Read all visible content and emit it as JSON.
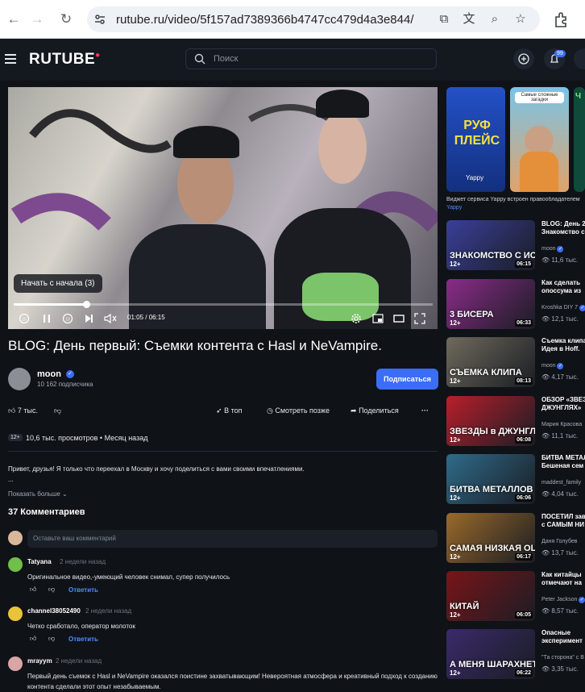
{
  "browser": {
    "url": "rutube.ru/video/5f157ad7389366b4747cc479d4a3e844/"
  },
  "header": {
    "logo": "RUTUBE",
    "search_placeholder": "Поиск",
    "notifications_count": "99"
  },
  "player": {
    "tooltip": "Начать с начала (3)",
    "current_time": "01:05",
    "duration": "06:15",
    "time_display": "01:05 / 06:15",
    "progress": 0.173
  },
  "video": {
    "title": "BLOG: День первый: Съемки контента с Hasl и NeVampire.",
    "channel": "moon",
    "subscribers": "10 162 подписчика",
    "subscribe_label": "Подписаться",
    "likes": "7 тыс.",
    "to_top_label": "В топ",
    "watch_later_label": "Смотреть позже",
    "share_label": "Поделиться",
    "age_rating": "12+",
    "views": "10,6 тыс. просмотров",
    "published": "Месяц назад",
    "description_line1": "Привет, друзья! Я только что переехал в Москву и хочу поделиться с вами своими впечатлениями.",
    "description_line2": "...",
    "show_more": "Показать больше"
  },
  "comments": {
    "count_label": "37 Комментариев",
    "input_placeholder": "Оставьте ваш комментарий",
    "reply_label": "Ответить",
    "items": [
      {
        "author": "Tatyana",
        "date": "2 недели назад",
        "text": "Оригинальное видео,-умеющий человек снимал, супер получилось",
        "color": "#6fbf4a"
      },
      {
        "author": "channel38052490",
        "date": "2 недели назад",
        "text": "Четко сработало, оператор молоток",
        "color": "#e9c33a"
      },
      {
        "author": "mrayym",
        "date": "2 недели назад",
        "text": "Первый день съемок с Hasl и NeVampire оказался поистине захватывающим! Невероятная атмосфера и креативный подход к созданию контента сделали этот опыт незабываемым.",
        "color": "#d9a5a5"
      }
    ]
  },
  "sidebar": {
    "shorts": [
      {
        "label": "РУФ ПЛЕЙС",
        "sub": "Yappy",
        "color": "#1b3fa0"
      },
      {
        "label": "Самые сложные загадки",
        "color": "#e0a36a"
      },
      {
        "label": "Ч",
        "color": "#0f4a3a"
      }
    ],
    "shorts_caption": "Виджет сервиса Yappy встроен правообладателем",
    "shorts_source": "Yappy",
    "recommendations": [
      {
        "thumb_label": "ЗНАКОМСТВО С ИСПОЛНИТЕЛЕМ",
        "title1": "BLOG: День 2",
        "title2": "Знакомство с",
        "channel": "moon",
        "views": "11,6 тыс.",
        "duration": "06:15",
        "age": "12+",
        "color": "#3a3f9a",
        "verified": true
      },
      {
        "thumb_label": "3 БИСЕРА",
        "title1": "Как сделать",
        "title2": "опоссума из",
        "channel": "Kroshka DIY 7",
        "views": "12,1 тыс.",
        "duration": "06:33",
        "age": "12+",
        "color": "#8b2b88",
        "verified": true
      },
      {
        "thumb_label": "СЪЕМКА КЛИПА",
        "title1": "Съемка клипа",
        "title2": "Идея в Hoff.",
        "channel": "moon",
        "views": "4,17 тыс.",
        "duration": "08:13",
        "age": "12+",
        "color": "#6f6a5c",
        "verified": true
      },
      {
        "thumb_label": "ЗВЕЗДЫ в ДЖУНГЛЯХ",
        "title1": "ОБЗОР «ЗВЕЗ",
        "title2": "ДЖУНГЛЯХ»",
        "channel": "Мария Красова",
        "views": "11,1 тыс.",
        "duration": "06:08",
        "age": "12+",
        "color": "#b81f2b",
        "verified": false
      },
      {
        "thumb_label": "БИТВА МЕТАЛЛОВ",
        "title1": "БИТВА МЕТАЛ",
        "title2": "Бешеная сем",
        "channel": "maddest_family",
        "views": "4,04 тыс.",
        "duration": "06:06",
        "age": "12+",
        "color": "#2f6b8a",
        "verified": false
      },
      {
        "thumb_label": "САМАЯ НИЗКАЯ ОЦЕНКА!",
        "title1": "ПОСЕТИЛ зав",
        "title2": "с САМЫМ НИ",
        "channel": "Даня Голубев",
        "views": "13,7 тыс.",
        "duration": "06:17",
        "age": "12+",
        "color": "#9a6a2a",
        "verified": false
      },
      {
        "thumb_label": "КИТАЙ",
        "title1": "Как китайцы",
        "title2": "отмечают на",
        "channel": "Peter Jackson",
        "views": "8,57 тыс.",
        "duration": "06:05",
        "age": "12+",
        "color": "#7a1418",
        "verified": true
      },
      {
        "thumb_label": "А МЕНЯ ШАРАХНЕТ?",
        "title1": "Опасные",
        "title2": "эксперимент",
        "channel": "\"Та сторона\" с В",
        "views": "3,35 тыс.",
        "duration": "06:22",
        "age": "12+",
        "color": "#3a2a6a",
        "verified": false
      }
    ]
  },
  "colors": {
    "background": "#0f1217",
    "accent": "#3b6ef5",
    "logo_dot": "#ff3b5c",
    "reply": "#4f8cff"
  },
  "icons": [
    "back-icon",
    "forward-icon",
    "reload-icon",
    "site-settings-icon",
    "open-external-icon",
    "translate-icon",
    "zoom-icon",
    "bookmark-star-icon",
    "extensions-icon",
    "menu-icon",
    "search-icon",
    "upload-icon",
    "bell-icon",
    "rewind-icon",
    "pause-icon",
    "forward-10-icon",
    "next-icon",
    "mute-icon",
    "settings-icon",
    "miniplayer-icon",
    "theater-icon",
    "fullscreen-icon",
    "like-icon",
    "dislike-icon",
    "rocket-icon",
    "clock-icon",
    "share-icon",
    "more-icon",
    "verified-icon",
    "eye-icon"
  ]
}
